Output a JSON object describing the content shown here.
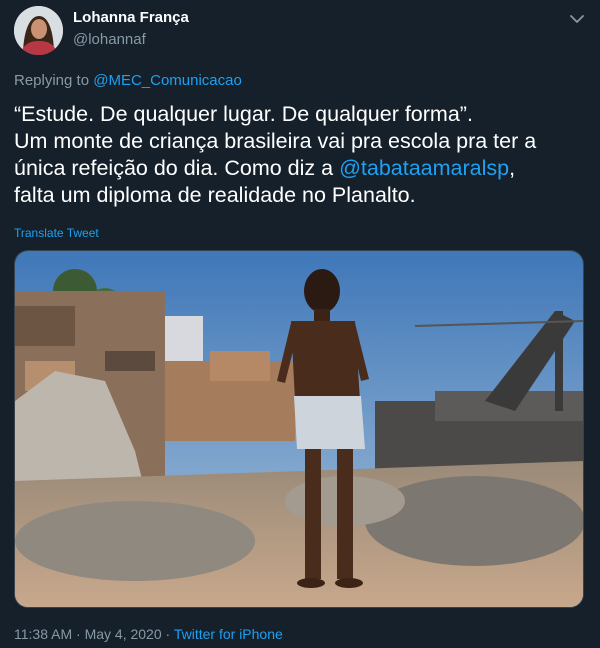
{
  "tweet": {
    "author_name": "Lohanna França",
    "author_handle": "@lohannaf",
    "replying_to_prefix": "Replying to ",
    "replying_to_handle": "@MEC_Comunicacao",
    "text_line1": "“Estude. De qualquer lugar. De qualquer forma”.",
    "text_line2": "Um monte de criança brasileira vai pra escola pra ter a",
    "text_line3_a": "única refeição do dia. Como diz a ",
    "text_line3_mention": "@tabataamaralsp",
    "text_line3_b": ",",
    "text_line4": "falta um diploma de realidade no Planalto.",
    "translate_label": "Translate Tweet",
    "time": "11:38 AM",
    "separator1": " · ",
    "date": "May 4, 2020",
    "separator2": " · ",
    "source": "Twitter for iPhone"
  },
  "icons": {
    "more": "chevron-down-icon"
  },
  "colors": {
    "background": "#15202b",
    "primary_text": "#ffffff",
    "secondary_text": "#8899a6",
    "link": "#1da1f2"
  }
}
